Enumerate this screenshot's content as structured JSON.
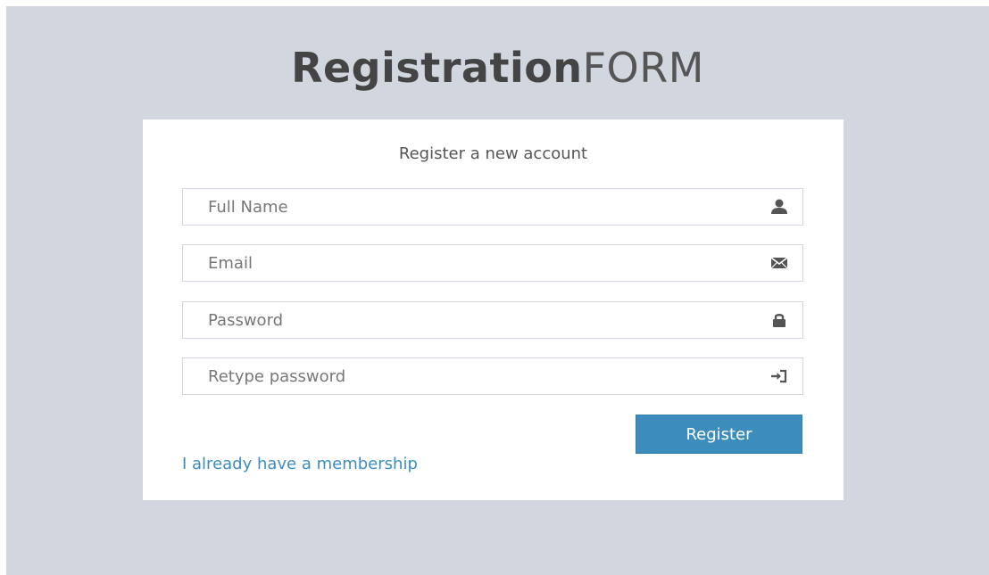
{
  "logo": {
    "bold": "Registration",
    "light": "FORM"
  },
  "box": {
    "message": "Register a new account"
  },
  "form": {
    "full_name": {
      "placeholder": "Full Name",
      "value": ""
    },
    "email": {
      "placeholder": "Email",
      "value": ""
    },
    "password": {
      "placeholder": "Password",
      "value": ""
    },
    "retype_password": {
      "placeholder": "Retype password",
      "value": ""
    },
    "submit_label": "Register"
  },
  "links": {
    "membership": "I already have a membership"
  },
  "icons": {
    "full_name": "user-icon",
    "email": "envelope-icon",
    "password": "lock-icon",
    "retype_password": "log-in-icon"
  },
  "colors": {
    "background": "#d2d6de",
    "accent": "#3c8dbc",
    "box": "#ffffff"
  }
}
